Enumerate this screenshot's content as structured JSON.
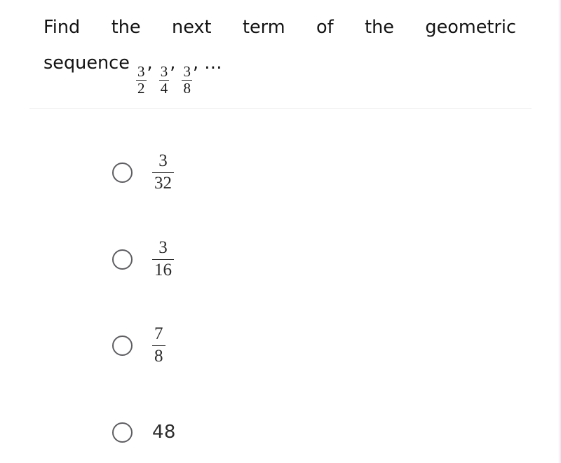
{
  "question": {
    "line1": "Find the next term of the geometric",
    "line2_prefix": "sequence",
    "sequence": [
      {
        "numerator": "3",
        "denominator": "2",
        "separator": ","
      },
      {
        "numerator": "3",
        "denominator": "4",
        "separator": ","
      },
      {
        "numerator": "3",
        "denominator": "8",
        "separator": ","
      }
    ],
    "ellipsis": "…"
  },
  "options": [
    {
      "type": "fraction",
      "numerator": "3",
      "denominator": "32",
      "selected": false
    },
    {
      "type": "fraction",
      "numerator": "3",
      "denominator": "16",
      "selected": false
    },
    {
      "type": "fraction",
      "numerator": "7",
      "denominator": "8",
      "selected": false
    },
    {
      "type": "plain",
      "value": "48",
      "selected": false
    }
  ],
  "colors": {
    "background": "#ffffff",
    "question_text": "#131313",
    "option_text": "#2b2b2b",
    "radio_border": "#5f5f63",
    "divider": "#ececef"
  }
}
